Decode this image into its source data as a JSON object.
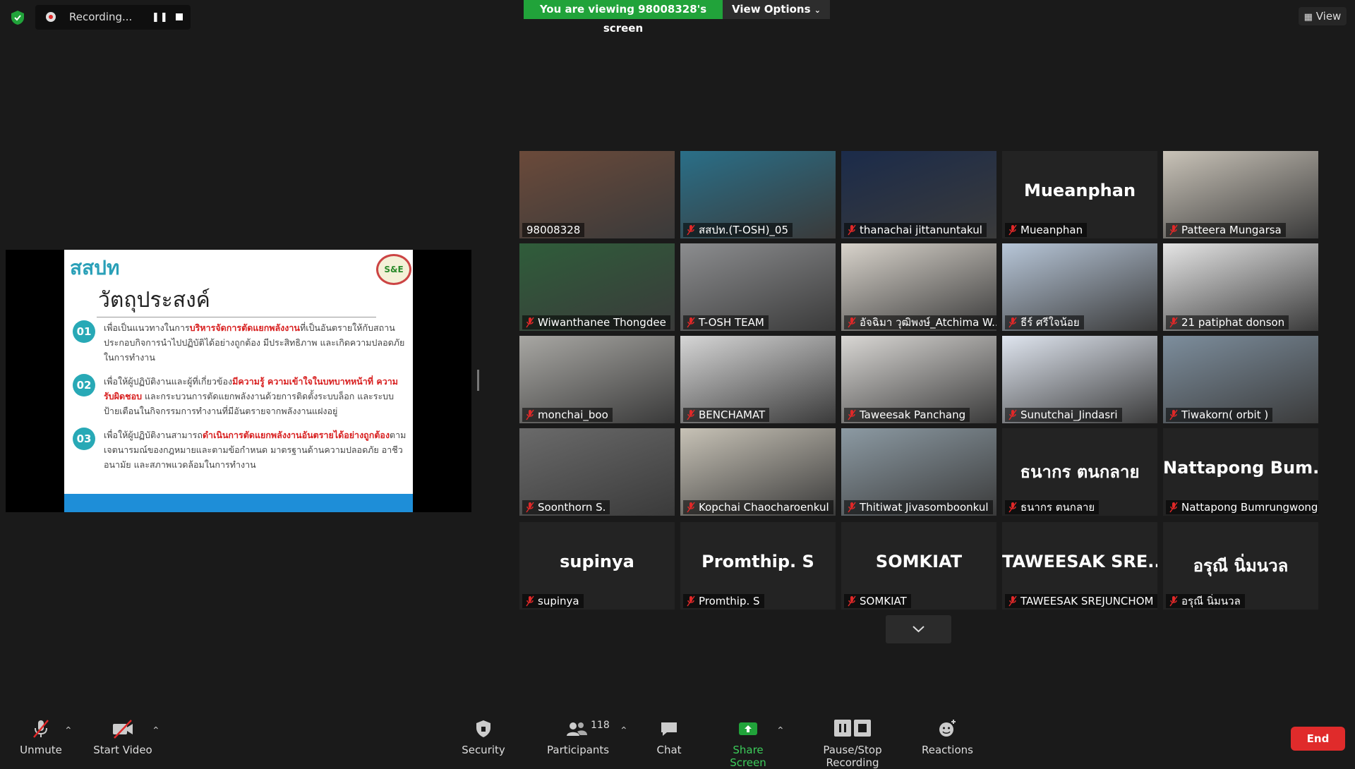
{
  "top": {
    "recording_label": "Recording...",
    "viewing_banner": "You are viewing 98008328's screen",
    "view_options_label": "View Options",
    "view_label": "View"
  },
  "slide": {
    "logo_text": "สสปท",
    "badge_text": "S&E",
    "title": "วัตถุประสงค์",
    "items": [
      {
        "num": "01",
        "pre": "เพื่อเป็นแนวทางในการ",
        "hl": "บริหารจัดการตัดแยกพลังงาน",
        "post": "ที่เป็นอันตรายให้กับสถานประกอบกิจการนำไปปฏิบัติได้อย่างถูกต้อง มีประสิทธิภาพ และเกิดความปลอดภัยในการทำงาน"
      },
      {
        "num": "02",
        "pre": "เพื่อให้ผู้ปฏิบัติงานและผู้ที่เกี่ยวข้อง",
        "hl": "มีความรู้ ความเข้าใจในบทบาทหน้าที่ ความรับผิดชอบ",
        "post": " และกระบวนการตัดแยกพลังงานด้วยการติดตั้งระบบล็อก และระบบป้ายเตือนในกิจกรรมการทำงานที่มีอันตรายจากพลังงานแฝงอยู่"
      },
      {
        "num": "03",
        "pre": "เพื่อให้ผู้ปฏิบัติงานสามารถ",
        "hl": "ดำเนินการตัดแยกพลังงานอันตรายได้อย่างถูกต้อง",
        "post": "ตามเจตนารมณ์ของกฎหมายและตามข้อกำหนด มาตรฐานด้านความปลอดภัย อาชีวอนามัย และสภาพแวดล้อมในการทำงาน"
      }
    ]
  },
  "participants": [
    {
      "name": "98008328",
      "video": true,
      "active": true,
      "muted": false
    },
    {
      "name": "สสปท.(T-OSH)_05",
      "video": true,
      "muted": true
    },
    {
      "name": "thanachai jittanuntakul",
      "video": true,
      "muted": true
    },
    {
      "name": "Mueanphan",
      "big": "Mueanphan",
      "video": false,
      "muted": true
    },
    {
      "name": "Patteera Mungarsa",
      "video": true,
      "muted": true
    },
    {
      "name": "Wiwanthanee Thongdee",
      "video": true,
      "muted": true
    },
    {
      "name": "T-OSH TEAM",
      "video": true,
      "muted": true
    },
    {
      "name": "อัจฉิมา วุฒิพงษ์_Atchima W...",
      "video": true,
      "muted": true
    },
    {
      "name": "ธีร์ ศรีใจน้อย",
      "video": true,
      "muted": true
    },
    {
      "name": "21 patiphat donson",
      "video": true,
      "muted": true
    },
    {
      "name": "monchai_boo",
      "video": true,
      "muted": true
    },
    {
      "name": "BENCHAMAT",
      "video": true,
      "muted": true
    },
    {
      "name": "Taweesak Panchang",
      "video": true,
      "muted": true
    },
    {
      "name": "Sunutchai_Jindasri",
      "video": true,
      "muted": true
    },
    {
      "name": "Tiwakorn( orbit )",
      "video": true,
      "muted": true
    },
    {
      "name": "Soonthorn S.",
      "video": true,
      "muted": true
    },
    {
      "name": "Kopchai Chaocharoenkul",
      "video": true,
      "muted": true
    },
    {
      "name": "Thitiwat Jivasomboonkul",
      "video": true,
      "muted": true
    },
    {
      "name": "ธนากร  ตนกลาย",
      "big": "ธนากร  ตนกลาย",
      "video": false,
      "muted": true
    },
    {
      "name": "Nattapong Bumrungwong",
      "big": "Nattapong  Bum...",
      "video": false,
      "muted": true
    },
    {
      "name": "supinya",
      "big": "supinya",
      "video": false,
      "muted": true
    },
    {
      "name": "Promthip. S",
      "big": "Promthip. S",
      "video": false,
      "muted": true
    },
    {
      "name": "SOMKIAT",
      "big": "SOMKIAT",
      "video": false,
      "muted": true
    },
    {
      "name": "TAWEESAK SREJUNCHOM",
      "big": "TAWEESAK  SRE...",
      "video": false,
      "muted": true
    },
    {
      "name": "อรุณี นิ่มนวล",
      "big": "อรุณี นิ่มนวล",
      "video": false,
      "muted": true
    }
  ],
  "toolbar": {
    "unmute": "Unmute",
    "start_video": "Start Video",
    "security": "Security",
    "participants": "Participants",
    "participant_count": "118",
    "chat": "Chat",
    "share_screen": "Share Screen",
    "pause_stop": "Pause/Stop Recording",
    "reactions": "Reactions",
    "end": "End"
  },
  "colors": {
    "accent_green": "#21a33a",
    "end_red": "#e02b2b",
    "active_speaker": "#c7e84a",
    "muted_red": "#e02828"
  }
}
